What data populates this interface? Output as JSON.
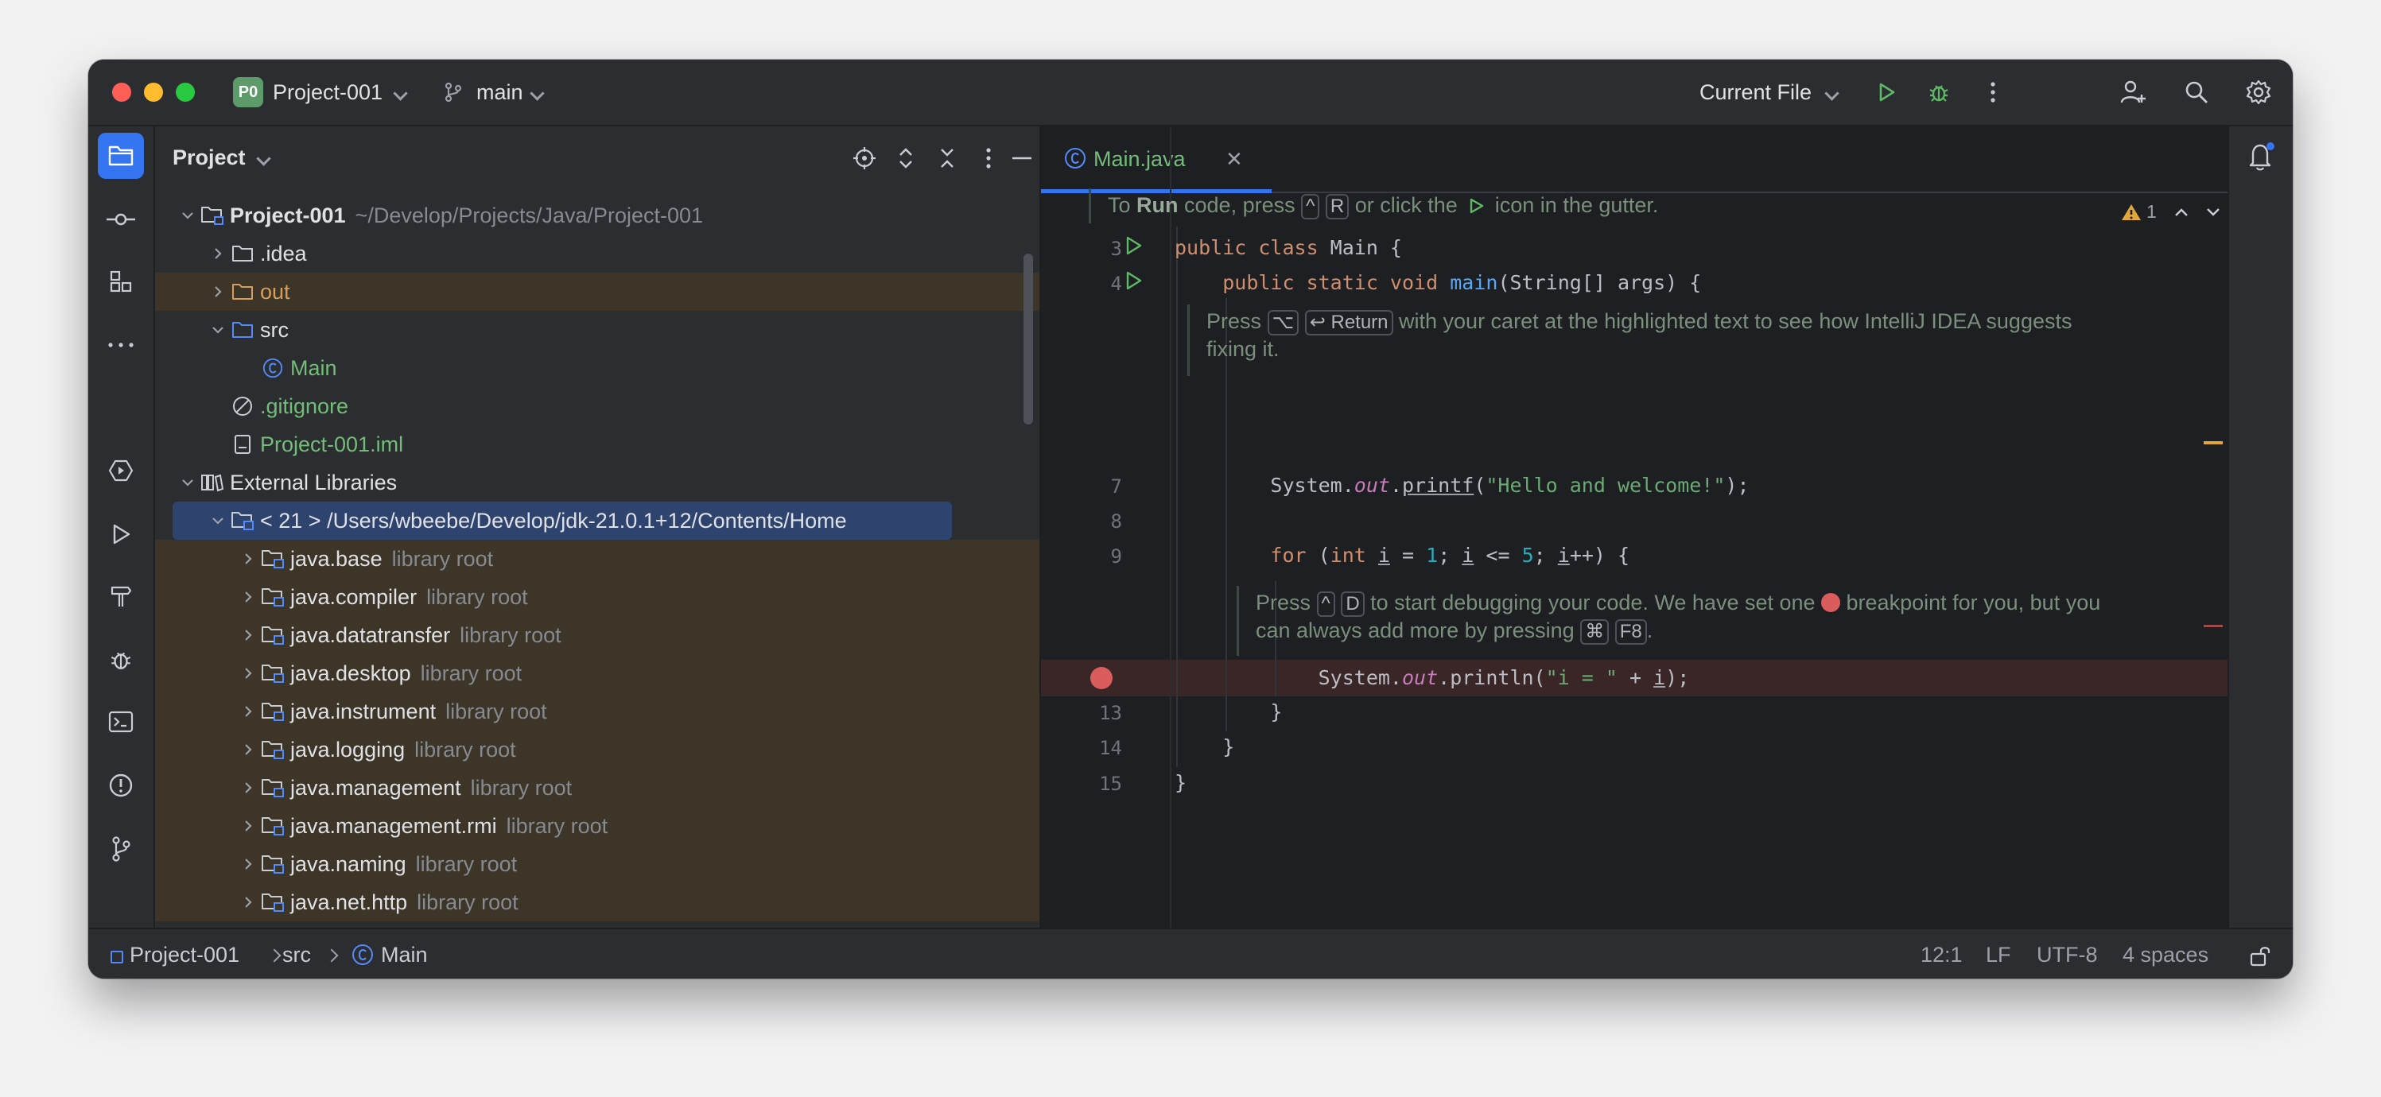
{
  "titlebar": {
    "project_badge": "P0",
    "project_name": "Project-001",
    "branch": "main",
    "run_config": "Current File"
  },
  "project_panel": {
    "title": "Project",
    "tree": [
      {
        "name": "Project-001",
        "suffix": "~/Develop/Projects/Java/Project-001",
        "indent": 0,
        "icon": "module-folder-icon",
        "expanded": true,
        "bold": true
      },
      {
        "name": ".idea",
        "suffix": "",
        "indent": 1,
        "icon": "folder-icon",
        "expanded": false
      },
      {
        "name": "out",
        "suffix": "",
        "indent": 1,
        "icon": "folder-orange-icon",
        "expanded": false,
        "style": "orange",
        "bg": "out"
      },
      {
        "name": "src",
        "suffix": "",
        "indent": 1,
        "icon": "source-folder-icon",
        "expanded": true
      },
      {
        "name": "Main",
        "suffix": "",
        "indent": 2,
        "icon": "class-icon",
        "style": "green",
        "leaf": true
      },
      {
        "name": ".gitignore",
        "suffix": "",
        "indent": 1,
        "icon": "ignore-file-icon",
        "style": "green",
        "leaf": true
      },
      {
        "name": "Project-001.iml",
        "suffix": "",
        "indent": 1,
        "icon": "iml-file-icon",
        "style": "green",
        "leaf": true
      },
      {
        "name": "External Libraries",
        "suffix": "",
        "indent": 0,
        "icon": "libraries-icon",
        "expanded": true
      },
      {
        "name": "< 21 >  /Users/wbeebe/Develop/jdk-21.0.1+12/Contents/Home",
        "suffix": "",
        "indent": 1,
        "icon": "jdk-folder-icon",
        "expanded": true,
        "selected": true
      },
      {
        "name": "java.base",
        "suffix": "library root",
        "indent": 2,
        "icon": "library-folder-icon",
        "expanded": false,
        "bg": "lib"
      },
      {
        "name": "java.compiler",
        "suffix": "library root",
        "indent": 2,
        "icon": "library-folder-icon",
        "expanded": false,
        "bg": "lib"
      },
      {
        "name": "java.datatransfer",
        "suffix": "library root",
        "indent": 2,
        "icon": "library-folder-icon",
        "expanded": false,
        "bg": "lib"
      },
      {
        "name": "java.desktop",
        "suffix": "library root",
        "indent": 2,
        "icon": "library-folder-icon",
        "expanded": false,
        "bg": "lib"
      },
      {
        "name": "java.instrument",
        "suffix": "library root",
        "indent": 2,
        "icon": "library-folder-icon",
        "expanded": false,
        "bg": "lib"
      },
      {
        "name": "java.logging",
        "suffix": "library root",
        "indent": 2,
        "icon": "library-folder-icon",
        "expanded": false,
        "bg": "lib"
      },
      {
        "name": "java.management",
        "suffix": "library root",
        "indent": 2,
        "icon": "library-folder-icon",
        "expanded": false,
        "bg": "lib"
      },
      {
        "name": "java.management.rmi",
        "suffix": "library root",
        "indent": 2,
        "icon": "library-folder-icon",
        "expanded": false,
        "bg": "lib"
      },
      {
        "name": "java.naming",
        "suffix": "library root",
        "indent": 2,
        "icon": "library-folder-icon",
        "expanded": false,
        "bg": "lib"
      },
      {
        "name": "java.net.http",
        "suffix": "library root",
        "indent": 2,
        "icon": "library-folder-icon",
        "expanded": false,
        "bg": "lib"
      }
    ]
  },
  "editor": {
    "tab_label": "Main.java",
    "warning_count": "1",
    "hint1": {
      "pre": "To ",
      "run": "Run",
      "mid": " code, press ",
      "key1": "^",
      "key2": "R",
      "post1": " or click the ",
      "post2": " icon in the gutter."
    },
    "hint2": {
      "pre": "Press ",
      "key1": "⌥",
      "key2": "↩ Return",
      "post": " with your caret at the highlighted text to see how IntelliJ IDEA suggests",
      "line2": "fixing it."
    },
    "hint3": {
      "pre": "Press ",
      "key1": "^",
      "key2": "D",
      "mid": " to start debugging your code. We have set one ",
      "post": " breakpoint for you, but you",
      "line2a": "can always add more by pressing ",
      "key3": "⌘",
      "key4": "F8",
      "line2b": "."
    },
    "line_numbers": [
      "3",
      "4",
      "7",
      "8",
      "9",
      "13",
      "14",
      "15"
    ]
  },
  "statusbar": {
    "crumb_project": "Project-001",
    "crumb_src": "src",
    "crumb_main": "Main",
    "position": "12:1",
    "line_sep": "LF",
    "encoding": "UTF-8",
    "indent": "4 spaces"
  }
}
